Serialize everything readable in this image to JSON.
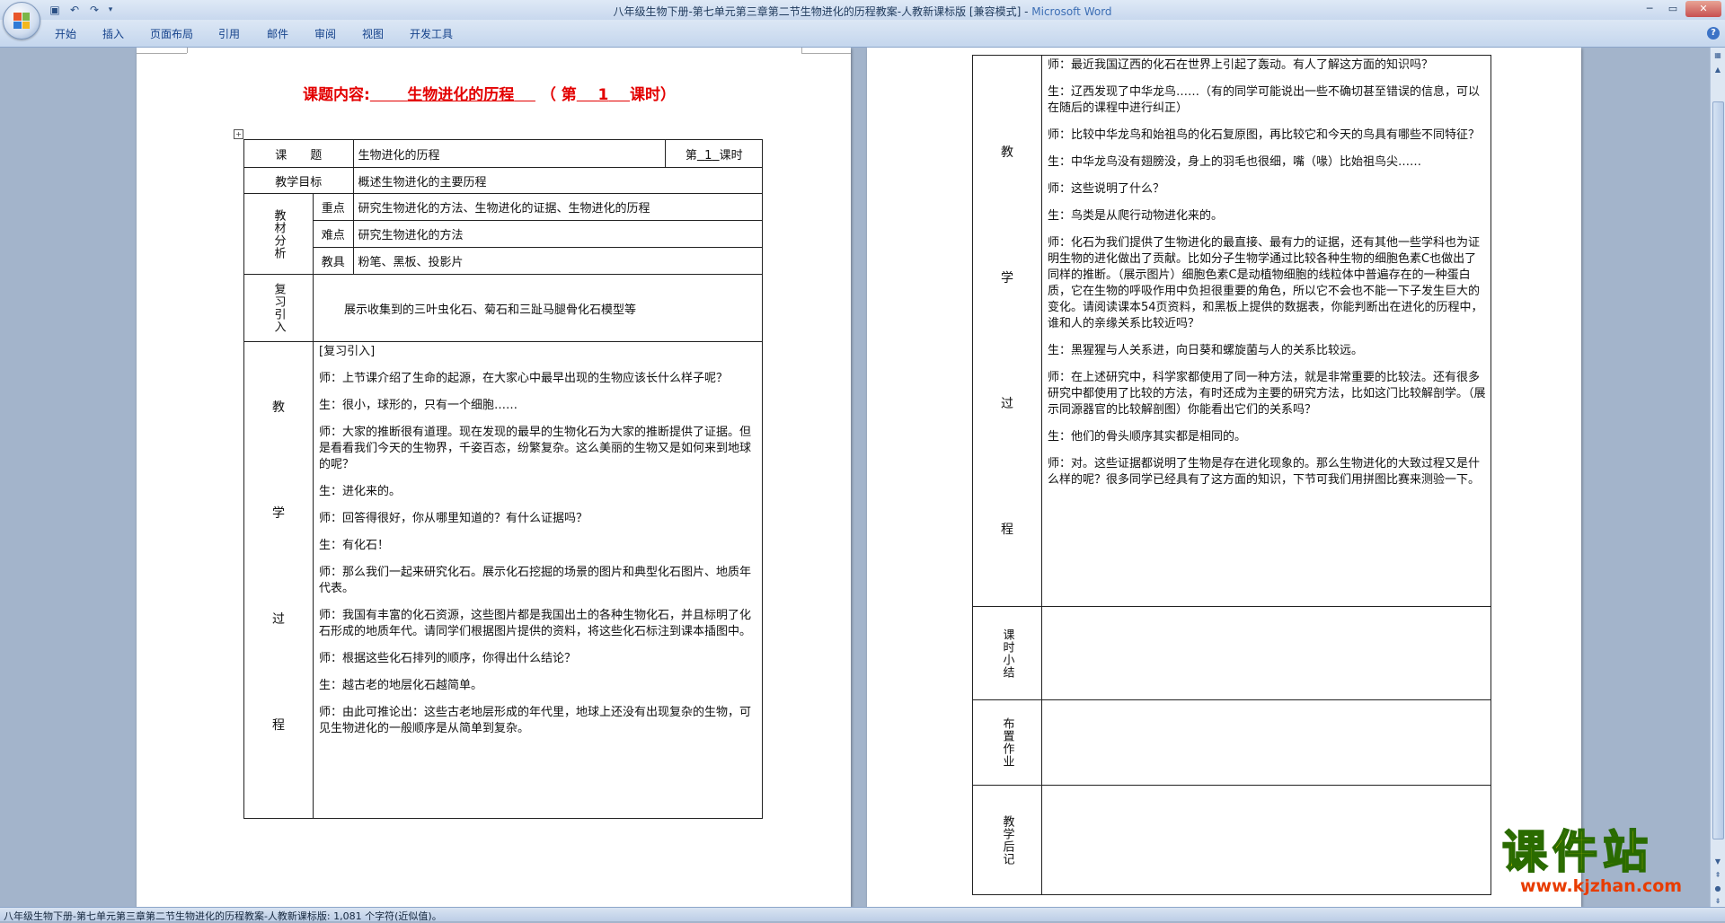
{
  "window": {
    "title": "八年级生物下册-第七单元第三章第二节生物进化的历程教案-人教新课标版 [兼容模式] - ",
    "app_name": "Microsoft Word"
  },
  "ribbon": {
    "tabs": [
      "开始",
      "插入",
      "页面布局",
      "引用",
      "邮件",
      "审阅",
      "视图",
      "开发工具"
    ]
  },
  "status": {
    "text": "八年级生物下册-第七单元第三章第二节生物进化的历程教案-人教新课标版: 1,081 个字符(近似值)。"
  },
  "page1": {
    "header_prefix": "课题内容:",
    "header_topic": "生物进化的历程",
    "header_lesson_open": "（  第",
    "header_lesson_no": "1",
    "header_lesson_close": "课时）",
    "table": {
      "topic_label": "课　　题",
      "topic_value": "生物进化的历程",
      "lesson_label_pre": "第",
      "lesson_no": "1",
      "lesson_label_post": "课时",
      "goal_label": "教学目标",
      "goal_value": "概述生物进化的主要历程",
      "analysis_label": "教材分析",
      "key_label": "重点",
      "key_value": "研究生物进化的方法、生物进化的证据、生物进化的历程",
      "difficulty_label": "难点",
      "difficulty_value": "研究生物进化的方法",
      "tools_label": "教具",
      "tools_value": "粉笔、黑板、投影片",
      "review_label": "复习引入",
      "review_value": "展示收集到的三叶虫化石、菊石和三趾马腿骨化石模型等",
      "process_label": [
        "教",
        "学",
        "过",
        "程"
      ],
      "process_lines": [
        "[复习引入]",
        "师：上节课介绍了生命的起源，在大家心中最早出现的生物应该长什么样子呢？",
        "生：很小，球形的，只有一个细胞……",
        "师：大家的推断很有道理。现在发现的最早的生物化石为大家的推断提供了证据。但是看看我们今天的生物界，千姿百态，纷繁复杂。这么美丽的生物又是如何来到地球的呢？",
        "生：进化来的。",
        "师：回答得很好，你从哪里知道的？有什么证据吗？",
        "生：有化石！",
        "师：那么我们一起来研究化石。展示化石挖掘的场景的图片和典型化石图片、地质年代表。",
        "师：我国有丰富的化石资源，这些图片都是我国出土的各种生物化石，并且标明了化石形成的地质年代。请同学们根据图片提供的资料，将这些化石标注到课本插图中。",
        "师：根据这些化石排列的顺序，你得出什么结论？",
        "生：越古老的地层化石越简单。",
        "师：由此可推论出：这些古老地层形成的年代里，地球上还没有出现复杂的生物，可见生物进化的一般顺序是从简单到复杂。"
      ]
    }
  },
  "page2": {
    "process_label": [
      "教",
      "学",
      "过",
      "程"
    ],
    "process_lines": [
      "师：最近我国辽西的化石在世界上引起了轰动。有人了解这方面的知识吗？",
      "生：辽西发现了中华龙鸟……（有的同学可能说出一些不确切甚至错误的信息，可以在随后的课程中进行纠正）",
      "师：比较中华龙鸟和始祖鸟的化石复原图，再比较它和今天的鸟具有哪些不同特征？",
      "生：中华龙鸟没有翅膀没，身上的羽毛也很细，嘴（喙）比始祖鸟尖……",
      "师：这些说明了什么？",
      "生：鸟类是从爬行动物进化来的。",
      "师：化石为我们提供了生物进化的最直接、最有力的证据，还有其他一些学科也为证明生物的进化做出了贡献。比如分子生物学通过比较各种生物的细胞色素C也做出了同样的推断。（展示图片）细胞色素C是动植物细胞的线粒体中普遍存在的一种蛋白质，它在生物的呼吸作用中负担很重要的角色，所以它不会也不能一下子发生巨大的变化。请阅读课本54页资料，和黑板上提供的数据表，你能判断出在进化的历程中，谁和人的亲缘关系比较近吗？",
      "生：黑猩猩与人关系进，向日葵和螺旋菌与人的关系比较远。",
      "师：在上述研究中，科学家都使用了同一种方法，就是非常重要的比较法。还有很多研究中都使用了比较的方法，有时还成为主要的研究方法，比如这门比较解剖学。（展示同源器官的比较解剖图）你能看出它们的关系吗？",
      "生：他们的骨头顺序其实都是相同的。",
      "师：对。这些证据都说明了生物是存在进化现象的。那么生物进化的大致过程又是什么样的呢？很多同学已经具有了这方面的知识，下节可我们用拼图比赛来测验一下。"
    ],
    "summary_label": "课时小结",
    "homework_label": "布置作业",
    "reflection_label": "教学后记"
  },
  "watermark": {
    "main": "课件站",
    "url": "www.kjzhan.com"
  }
}
